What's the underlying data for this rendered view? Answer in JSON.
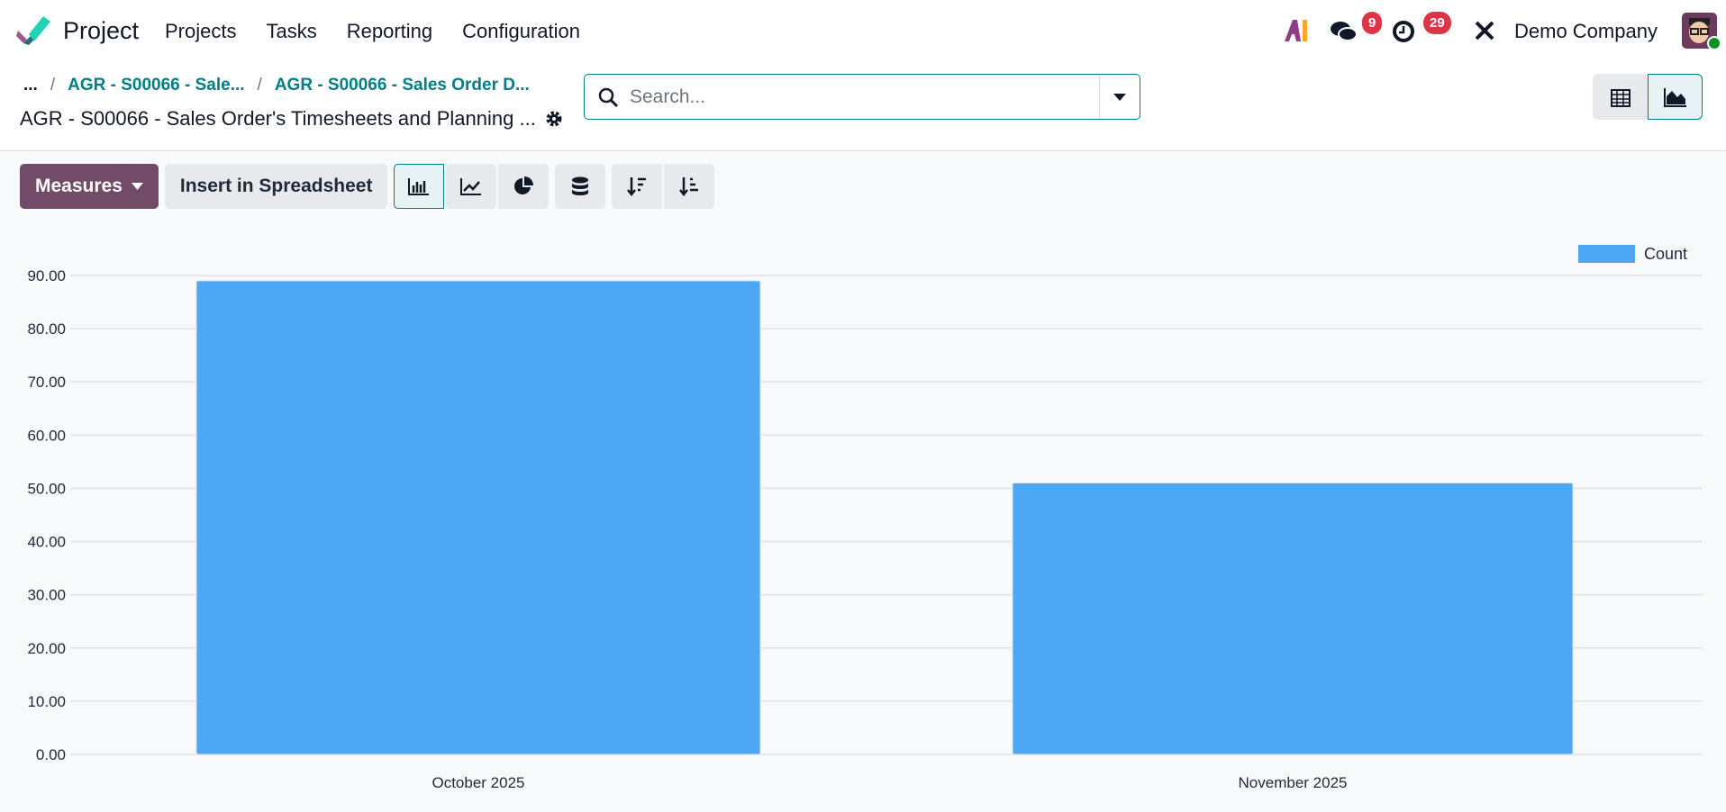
{
  "navbar": {
    "app_name": "Project",
    "menu": [
      "Projects",
      "Tasks",
      "Reporting",
      "Configuration"
    ],
    "messages_count": "9",
    "activities_count": "29",
    "company": "Demo Company"
  },
  "breadcrumb": {
    "ellipsis": "...",
    "items": [
      "AGR - S00066 - Sale...",
      "AGR - S00066 - Sales Order D..."
    ],
    "current": "AGR - S00066 - Sales Order's Timesheets and Planning ..."
  },
  "search": {
    "placeholder": "Search..."
  },
  "toolbar": {
    "measures_label": "Measures",
    "insert_label": "Insert in Spreadsheet"
  },
  "colors": {
    "bar": "#4ea7f2",
    "accent": "#017e84",
    "primary": "#714b67"
  },
  "chart_data": {
    "type": "bar",
    "categories": [
      "October 2025",
      "November 2025"
    ],
    "series": [
      {
        "name": "Count",
        "values": [
          89,
          51
        ]
      }
    ],
    "ylim": [
      0,
      90
    ],
    "yticks": [
      "0.00",
      "10.00",
      "20.00",
      "30.00",
      "40.00",
      "50.00",
      "60.00",
      "70.00",
      "80.00",
      "90.00"
    ],
    "legend": "top-right",
    "grid": true,
    "xlabel": "",
    "ylabel": "",
    "title": ""
  }
}
